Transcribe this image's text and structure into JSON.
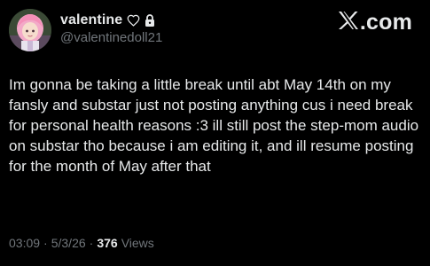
{
  "user": {
    "display_name": "valentine",
    "handle": "@valentinedoll21",
    "icons": [
      "heart-outline-icon",
      "lock-icon"
    ]
  },
  "brand": {
    "icon": "x-logo-icon",
    "suffix": ".com"
  },
  "tweet": {
    "text": "Im gonna be taking a little break until abt May 14th on my fansly and substar just not posting anything cus i need break for personal health reasons :3 ill still post the step-mom audio on substar tho because i am editing it, and ill resume posting for the month of May after that"
  },
  "meta": {
    "time": "03:09",
    "separator": "·",
    "date": "5/3/26",
    "views_count": "376",
    "views_label": "Views"
  },
  "colors": {
    "background": "#000000",
    "text_primary": "#e7e9ea",
    "text_secondary": "#71767b"
  }
}
